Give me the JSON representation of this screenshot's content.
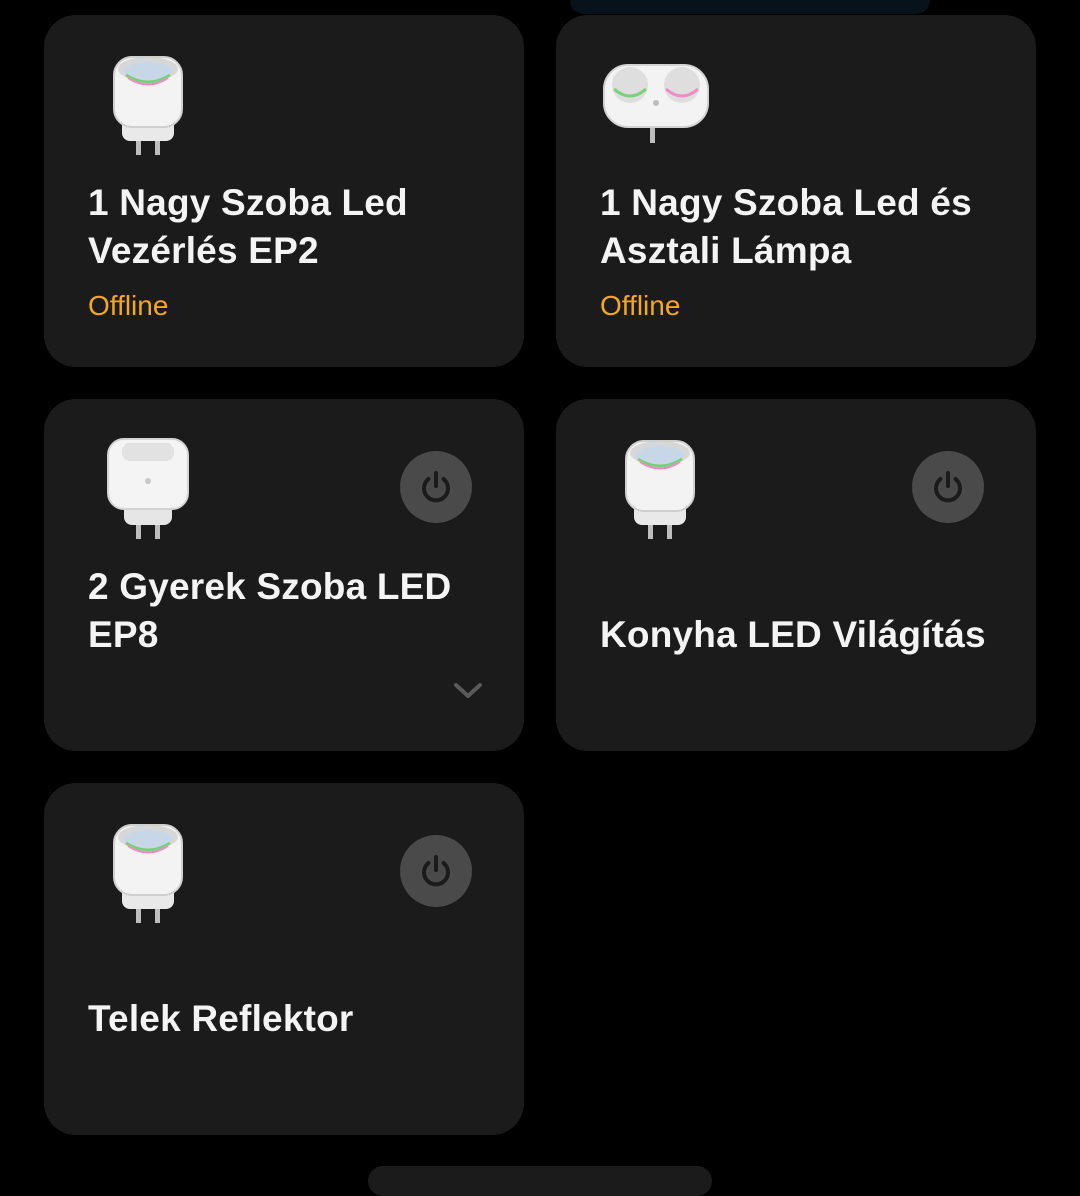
{
  "devices": [
    {
      "name": "1 Nagy Szoba Led Vezérlés EP2",
      "status": "Offline",
      "image": "smart-plug-round-icon"
    },
    {
      "name": "1 Nagy Szoba Led és Asztali Lámpa",
      "status": "Offline",
      "image": "smart-plug-double-icon"
    },
    {
      "name": "2 Gyerek Szoba LED EP8",
      "status": "",
      "image": "smart-plug-square-icon",
      "power_icon": "power-icon",
      "expand_icon": "chevron-down-icon"
    },
    {
      "name": "Konyha LED Világítás",
      "status": "",
      "image": "smart-plug-round-icon",
      "power_icon": "power-icon"
    },
    {
      "name": "Telek Reflektor",
      "status": "",
      "image": "smart-plug-round-icon",
      "power_icon": "power-icon"
    }
  ],
  "colors": {
    "background": "#000000",
    "card": "#1b1b1b",
    "title": "#f4f4f4",
    "offline": "#f5a623",
    "power_button": "#4a4a4a",
    "power_glyph": "#1b1b1b"
  }
}
